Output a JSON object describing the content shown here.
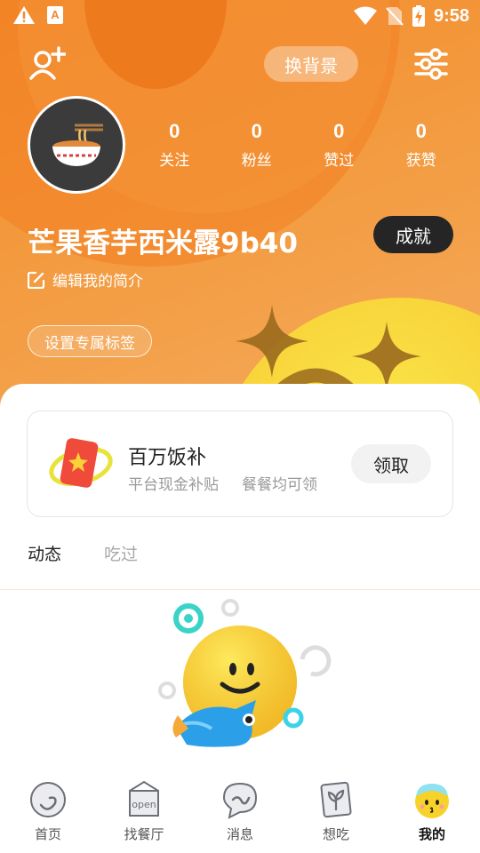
{
  "status_bar": {
    "time": "9:58",
    "icons": [
      "warning-icon",
      "app-notification-icon",
      "wifi-icon",
      "no-sim-icon",
      "battery-charging-icon"
    ]
  },
  "header": {
    "change_background_label": "换背景",
    "add_friend_icon": "add-user-icon",
    "settings_icon": "sliders-icon"
  },
  "profile": {
    "avatar_icon": "noodle-bowl-icon",
    "username": "芒果香芋西米露9b40",
    "edit_bio_label": "编辑我的简介",
    "set_tag_label": "设置专属标签",
    "achievements_label": "成就",
    "stats": [
      {
        "num": "0",
        "label": "关注"
      },
      {
        "num": "0",
        "label": "粉丝"
      },
      {
        "num": "0",
        "label": "赞过"
      },
      {
        "num": "0",
        "label": "获赞"
      }
    ]
  },
  "promo_card": {
    "icon": "red-envelope-icon",
    "title": "百万饭补",
    "subtitle_1": "平台现金补贴",
    "subtitle_2": "餐餐均可领",
    "claim_label": "领取"
  },
  "content_tabs": [
    {
      "label": "动态",
      "active": true
    },
    {
      "label": "吃过",
      "active": false
    }
  ],
  "bottom_nav": [
    {
      "label": "首页",
      "icon": "home-icon",
      "active": false
    },
    {
      "label": "找餐厅",
      "icon": "restaurant-icon",
      "active": false
    },
    {
      "label": "消息",
      "icon": "message-icon",
      "active": false
    },
    {
      "label": "想吃",
      "icon": "wishlist-icon",
      "active": false
    },
    {
      "label": "我的",
      "icon": "profile-face-icon",
      "active": true
    }
  ],
  "colors": {
    "accent_orange": "#f28a2a",
    "dark_button": "#252525",
    "muted_text": "#9a9a9a"
  }
}
